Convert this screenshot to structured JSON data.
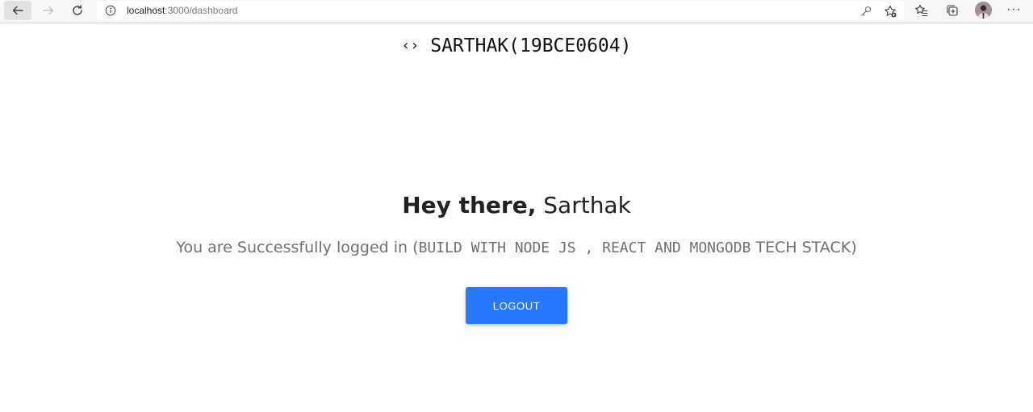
{
  "browser": {
    "url_host": "localhost",
    "url_rest": ":3000/dashboard",
    "more_label": "···"
  },
  "header": {
    "code_icon": "‹›",
    "title": "SARTHAK(19BCE0604)"
  },
  "main": {
    "greeting_lead": "Hey there,",
    "greeting_name": "Sarthak",
    "message_prefix": "You are Successfully logged in (",
    "message_stack": "BUILD WITH NODE JS , REACT AND MONGODB",
    "message_suffix": " TECH STACK)",
    "logout_label": "LOGOUT"
  },
  "colors": {
    "accent": "#2979ff",
    "text": "#212121",
    "muted": "#6f6f6f"
  }
}
